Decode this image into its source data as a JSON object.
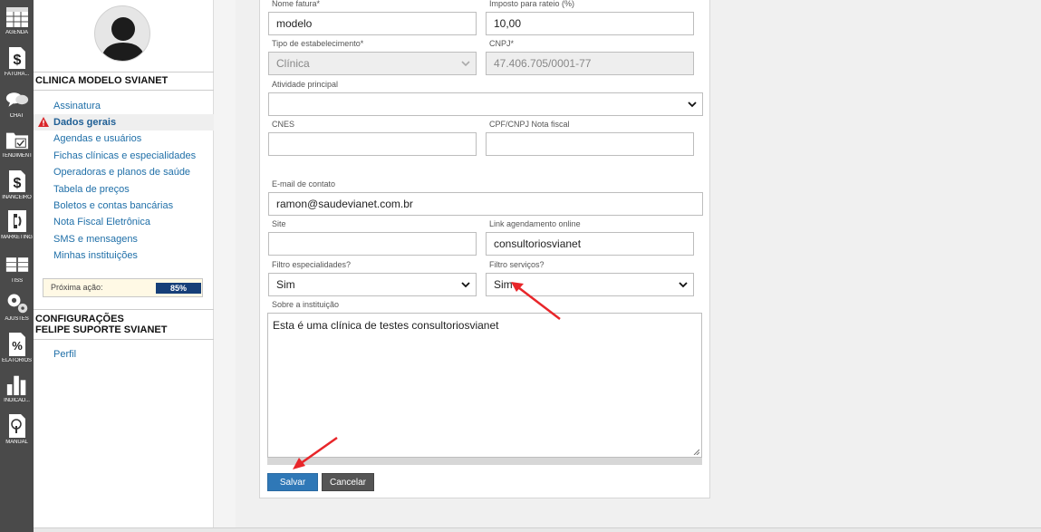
{
  "rail": [
    {
      "label": "AGENDA",
      "icon": "calendar-icon"
    },
    {
      "label": "FATURA...",
      "icon": "dollar-icon"
    },
    {
      "label": "CHAT",
      "icon": "chat-icon"
    },
    {
      "label": "TENDIMENT",
      "icon": "folder-check-icon"
    },
    {
      "label": "INANCEIRO",
      "icon": "dollar-icon"
    },
    {
      "label": "MARKETING",
      "icon": "phone-icon"
    },
    {
      "label": "TISS",
      "icon": "table-icon"
    },
    {
      "label": "AJUSTES",
      "icon": "gears-icon"
    },
    {
      "label": "ELATORIOS",
      "icon": "percent-icon"
    },
    {
      "label": "INDICAD...",
      "icon": "bar-chart-icon"
    },
    {
      "label": "MANUAL",
      "icon": "manual-icon"
    }
  ],
  "sidebar": {
    "clinic_title": "CLINICA MODELO SVIANET",
    "items": [
      {
        "label": "Assinatura"
      },
      {
        "label": "Dados gerais",
        "active": true
      },
      {
        "label": "Agendas e usuários"
      },
      {
        "label": "Fichas clínicas e especialidades"
      },
      {
        "label": "Operadoras e planos de saúde"
      },
      {
        "label": "Tabela de preços"
      },
      {
        "label": "Boletos e contas bancárias"
      },
      {
        "label": "Nota Fiscal Eletrônica"
      },
      {
        "label": "SMS e mensagens"
      },
      {
        "label": "Minhas instituições"
      }
    ],
    "progress": {
      "label": "Próxima ação:",
      "value_text": "85%",
      "value": 85
    },
    "config_title_line1": "CONFIGURAÇÕES",
    "config_title_line2": "FELIPE SUPORTE SVIANET",
    "config_items": [
      {
        "label": "Perfil"
      }
    ]
  },
  "form": {
    "nome_fatura": {
      "label": "Nome fatura*",
      "value": "modelo"
    },
    "imposto": {
      "label": "Imposto para rateio (%)",
      "value": "10,00"
    },
    "tipo": {
      "label": "Tipo de estabelecimento*",
      "value": "Clínica"
    },
    "cnpj": {
      "label": "CNPJ*",
      "value": "47.406.705/0001-77"
    },
    "atividade": {
      "label": "Atividade principal",
      "value": ""
    },
    "cnes": {
      "label": "CNES",
      "value": ""
    },
    "cpf_cnpj_nf": {
      "label": "CPF/CNPJ Nota fiscal",
      "value": ""
    },
    "email": {
      "label": "E-mail de contato",
      "value": "ramon@saudevianet.com.br"
    },
    "site": {
      "label": "Site",
      "value": ""
    },
    "link": {
      "label": "Link agendamento online",
      "value": "consultoriosvianet"
    },
    "filtro_esp": {
      "label": "Filtro especialidades?",
      "value": "Sim"
    },
    "filtro_serv": {
      "label": "Filtro serviços?",
      "value": "Sim"
    },
    "sobre": {
      "label": "Sobre a instituição",
      "value": "Esta é uma clínica de testes consultoriosvianet"
    },
    "save_label": "Salvar",
    "cancel_label": "Cancelar"
  },
  "colors": {
    "accent": "#2f78b7",
    "annotation": "#e8262a",
    "rail": "#4a4a4a"
  }
}
